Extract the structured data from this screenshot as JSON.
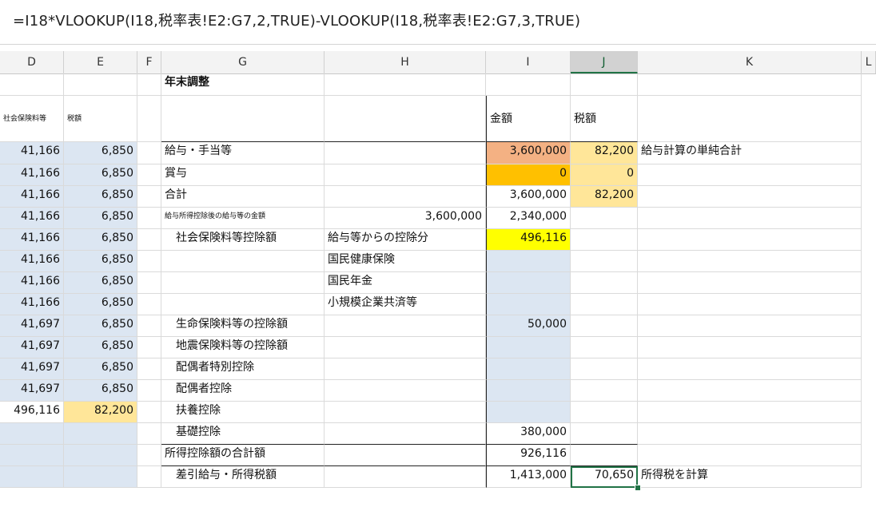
{
  "formula": "=I18*VLOOKUP(I18,税率表!E2:G7,2,TRUE)-VLOOKUP(I18,税率表!E2:G7,3,TRUE)",
  "columns": [
    "D",
    "E",
    "F",
    "G",
    "H",
    "I",
    "J",
    "K"
  ],
  "selected_column": "J",
  "colors": {
    "light_blue": "#dce6f2",
    "salmon": "#f4b183",
    "orange": "#ffc000",
    "light_yellow": "#ffe699",
    "yellow": "#ffff00",
    "selection_green": "#217346"
  },
  "rows": [
    {
      "D": "",
      "E": "",
      "G": "年末調整",
      "H": "",
      "I": "",
      "J": "",
      "K": ""
    },
    {
      "D": "社会保険料等",
      "E": "税額",
      "G": "",
      "H": "",
      "I": "金額",
      "J": "税額",
      "K": ""
    },
    {
      "D": "41,166",
      "E": "6,850",
      "G": "給与・手当等",
      "H": "",
      "I": "3,600,000",
      "J": "82,200",
      "K": "給与計算の単純合計"
    },
    {
      "D": "41,166",
      "E": "6,850",
      "G": "賞与",
      "H": "",
      "I": "0",
      "J": "0",
      "K": ""
    },
    {
      "D": "41,166",
      "E": "6,850",
      "G": "合計",
      "H": "",
      "I": "3,600,000",
      "J": "82,200",
      "K": ""
    },
    {
      "D": "41,166",
      "E": "6,850",
      "G": "給与所得控除後の給与等の金額",
      "H": "3,600,000",
      "I": "2,340,000",
      "J": "",
      "K": ""
    },
    {
      "D": "41,166",
      "E": "6,850",
      "G": "社会保険料等控除額",
      "H": "給与等からの控除分",
      "I": "496,116",
      "J": "",
      "K": ""
    },
    {
      "D": "41,166",
      "E": "6,850",
      "G": "",
      "H": "国民健康保険",
      "I": "",
      "J": "",
      "K": ""
    },
    {
      "D": "41,166",
      "E": "6,850",
      "G": "",
      "H": "国民年金",
      "I": "",
      "J": "",
      "K": ""
    },
    {
      "D": "41,166",
      "E": "6,850",
      "G": "",
      "H": "小規模企業共済等",
      "I": "",
      "J": "",
      "K": ""
    },
    {
      "D": "41,697",
      "E": "6,850",
      "G": "生命保険料等の控除額",
      "H": "",
      "I": "50,000",
      "J": "",
      "K": ""
    },
    {
      "D": "41,697",
      "E": "6,850",
      "G": "地震保険料等の控除額",
      "H": "",
      "I": "",
      "J": "",
      "K": ""
    },
    {
      "D": "41,697",
      "E": "6,850",
      "G": "配偶者特別控除",
      "H": "",
      "I": "",
      "J": "",
      "K": ""
    },
    {
      "D": "41,697",
      "E": "6,850",
      "G": "配偶者控除",
      "H": "",
      "I": "",
      "J": "",
      "K": ""
    },
    {
      "D": "496,116",
      "E": "82,200",
      "G": "扶養控除",
      "H": "",
      "I": "",
      "J": "",
      "K": ""
    },
    {
      "D": "",
      "E": "",
      "G": "基礎控除",
      "H": "",
      "I": "380,000",
      "J": "",
      "K": ""
    },
    {
      "D": "",
      "E": "",
      "G": "所得控除額の合計額",
      "H": "",
      "I": "926,116",
      "J": "",
      "K": ""
    },
    {
      "D": "",
      "E": "",
      "G": "差引給与・所得税額",
      "H": "",
      "I": "1,413,000",
      "J": "70,650",
      "K": "所得税を計算"
    }
  ]
}
